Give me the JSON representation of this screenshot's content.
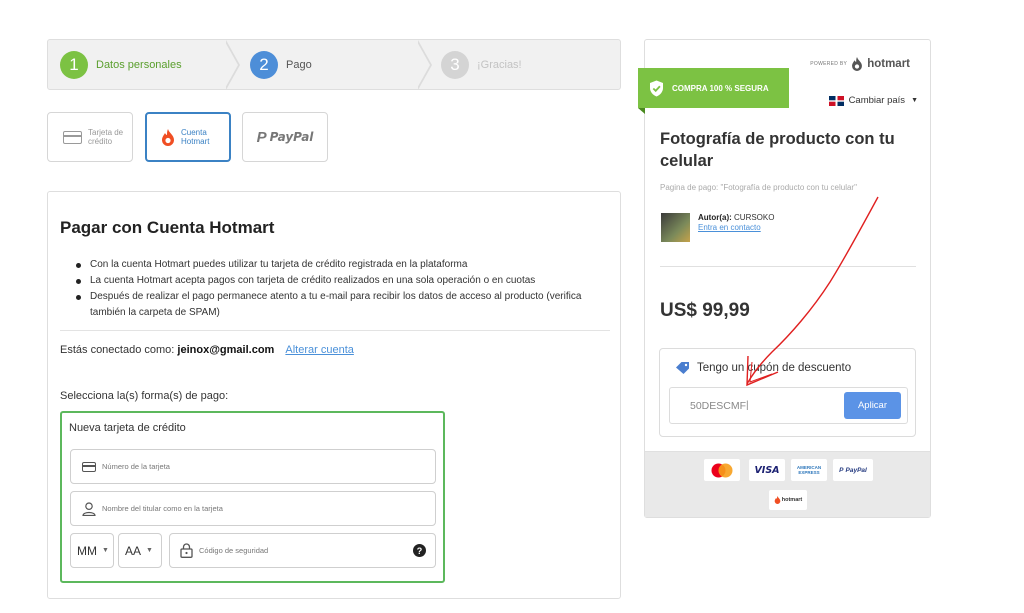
{
  "stepper": {
    "steps": [
      {
        "number": "1",
        "label": "Datos personales"
      },
      {
        "number": "2",
        "label": "Pago"
      },
      {
        "number": "3",
        "label": "¡Gracias!"
      }
    ]
  },
  "payment_methods": {
    "card_label_line1": "Tarjeta de",
    "card_label_line2": "crédito",
    "hotmart_label_line1": "Cuenta",
    "hotmart_label_line2": "Hotmart",
    "paypal_label": "PayPal",
    "paypal_symbol": "P"
  },
  "panel": {
    "title": "Pagar con Cuenta Hotmart",
    "bullets": [
      "Con la cuenta Hotmart puedes utilizar tu tarjeta de crédito registrada en la plataforma",
      "La cuenta Hotmart acepta pagos con tarjeta de crédito realizados en una sola operación o en cuotas",
      "Después de realizar el pago permanece atento a tu e-mail para recibir los datos de acceso al producto (verifica también la carpeta de SPAM)"
    ],
    "connected_prefix": "Estás conectado como:",
    "connected_email": "jeinox@gmail.com",
    "change_account": "Alterar cuenta",
    "select_label": "Selecciona la(s) forma(s) de pago:",
    "new_card_title": "Nueva tarjeta de crédito",
    "card_number_placeholder": "Número de la tarjeta",
    "holder_placeholder": "Nombre del titular como en la tarjeta",
    "month_value": "MM",
    "year_value": "AA",
    "cvv_placeholder": "Código de seguridad",
    "help_symbol": "?"
  },
  "summary": {
    "powered_by": "POWERED BY",
    "brand": "hotmart",
    "secure_badge": "COMPRA 100 % SEGURA",
    "change_country": "Cambiar país",
    "product_title": "Fotografía de producto con tu celular",
    "page_description": "Pagina de pago: \"Fotografía de producto con tu celular\"",
    "author_label": "Autor(a):",
    "author_name": "CURSOKO",
    "contact_link": "Entra en contacto",
    "price": "US$ 99,99",
    "coupon_label": "Tengo un cupón de descuento",
    "coupon_value": "50DESCMF",
    "apply_button": "Aplicar",
    "footer_logos": {
      "visa": "VISA",
      "amex_line1": "AMERICAN",
      "amex_line2": "EXPRESS",
      "paypal": "PayPal",
      "hotmart": "hotmart"
    }
  },
  "colors": {
    "accent_green": "#7cc243",
    "accent_blue": "#4d8ed8",
    "button_blue": "#5b93e6",
    "annotation_red": "#e02020"
  }
}
